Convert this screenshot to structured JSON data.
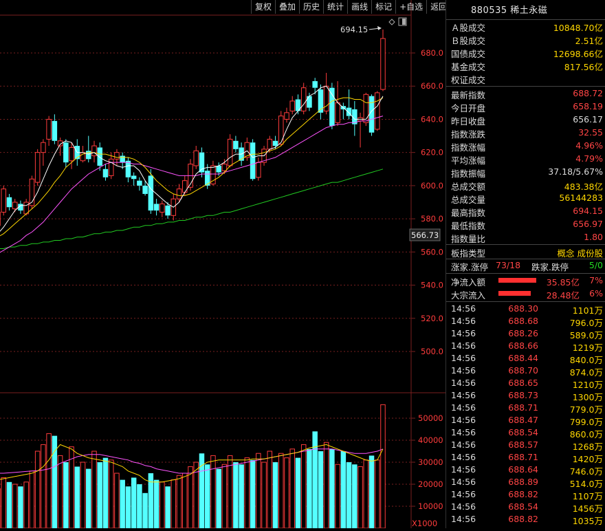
{
  "toolbar": {
    "items": [
      "复权",
      "叠加",
      "历史",
      "统计",
      "画线",
      "标记",
      "+自选",
      "返回"
    ]
  },
  "chart": {
    "high_marker_label": "694.15",
    "current_price_label": "566.73",
    "price_axis": [
      "680.0",
      "660.0",
      "640.0",
      "620.0",
      "600.0",
      "580.0",
      "560.0",
      "540.0",
      "520.0",
      "500.0"
    ],
    "volume_axis": [
      "50000",
      "40000",
      "30000",
      "20000",
      "10000"
    ],
    "volume_unit": "X1000",
    "colors": {
      "up": "#ff3c3c",
      "down": "#54ffff",
      "ma5": "#ffffff",
      "ma10": "#ffd700",
      "ma20": "#ff55ff",
      "ma60": "#22cc22",
      "grid": "#7a1f1f"
    }
  },
  "chart_data": {
    "type": "candlestick",
    "price_ylim": [
      496,
      700
    ],
    "volume_ylim": [
      0,
      58000
    ],
    "candles": [
      {
        "o": 576,
        "c": 584,
        "h": 586,
        "l": 574,
        "v": 18000
      },
      {
        "o": 584,
        "c": 598,
        "h": 600,
        "l": 582,
        "v": 23000
      },
      {
        "o": 593,
        "c": 587,
        "h": 595,
        "l": 585,
        "v": 21000
      },
      {
        "o": 586,
        "c": 590,
        "h": 592,
        "l": 584,
        "v": 20000
      },
      {
        "o": 589,
        "c": 585,
        "h": 591,
        "l": 583,
        "v": 19000
      },
      {
        "o": 583,
        "c": 590,
        "h": 592,
        "l": 582,
        "v": 21000
      },
      {
        "o": 588,
        "c": 604,
        "h": 606,
        "l": 586,
        "v": 26000
      },
      {
        "o": 602,
        "c": 620,
        "h": 622,
        "l": 600,
        "v": 35000
      },
      {
        "o": 620,
        "c": 626,
        "h": 628,
        "l": 612,
        "v": 38000
      },
      {
        "o": 628,
        "c": 640,
        "h": 642,
        "l": 624,
        "v": 43000
      },
      {
        "o": 639,
        "c": 627,
        "h": 643,
        "l": 625,
        "v": 42000
      },
      {
        "o": 624,
        "c": 627,
        "h": 629,
        "l": 618,
        "v": 33000
      },
      {
        "o": 626,
        "c": 614,
        "h": 628,
        "l": 611,
        "v": 30000
      },
      {
        "o": 615,
        "c": 623,
        "h": 626,
        "l": 610,
        "v": 37000
      },
      {
        "o": 624,
        "c": 616,
        "h": 628,
        "l": 612,
        "v": 28000
      },
      {
        "o": 615,
        "c": 620,
        "h": 624,
        "l": 614,
        "v": 30000
      },
      {
        "o": 621,
        "c": 616,
        "h": 630,
        "l": 614,
        "v": 27000
      },
      {
        "o": 618,
        "c": 624,
        "h": 627,
        "l": 614,
        "v": 35000
      },
      {
        "o": 623,
        "c": 612,
        "h": 626,
        "l": 609,
        "v": 30000
      },
      {
        "o": 610,
        "c": 605,
        "h": 613,
        "l": 603,
        "v": 32000
      },
      {
        "o": 606,
        "c": 616,
        "h": 620,
        "l": 604,
        "v": 31000
      },
      {
        "o": 616,
        "c": 620,
        "h": 622,
        "l": 612,
        "v": 25000
      },
      {
        "o": 618,
        "c": 614,
        "h": 620,
        "l": 610,
        "v": 22000
      },
      {
        "o": 615,
        "c": 605,
        "h": 617,
        "l": 602,
        "v": 19000
      },
      {
        "o": 606,
        "c": 604,
        "h": 608,
        "l": 600,
        "v": 23000
      },
      {
        "o": 603,
        "c": 600,
        "h": 605,
        "l": 597,
        "v": 20000
      },
      {
        "o": 600,
        "c": 595,
        "h": 603,
        "l": 594,
        "v": 16000
      },
      {
        "o": 606,
        "c": 585,
        "h": 610,
        "l": 583,
        "v": 25000
      },
      {
        "o": 589,
        "c": 585,
        "h": 592,
        "l": 582,
        "v": 22000
      },
      {
        "o": 584,
        "c": 589,
        "h": 591,
        "l": 581,
        "v": 21000
      },
      {
        "o": 588,
        "c": 582,
        "h": 590,
        "l": 580,
        "v": 19000
      },
      {
        "o": 582,
        "c": 592,
        "h": 595,
        "l": 579,
        "v": 22000
      },
      {
        "o": 592,
        "c": 598,
        "h": 601,
        "l": 590,
        "v": 24000
      },
      {
        "o": 596,
        "c": 603,
        "h": 606,
        "l": 594,
        "v": 25000
      },
      {
        "o": 599,
        "c": 613,
        "h": 616,
        "l": 597,
        "v": 28000
      },
      {
        "o": 612,
        "c": 621,
        "h": 624,
        "l": 610,
        "v": 30000
      },
      {
        "o": 620,
        "c": 608,
        "h": 623,
        "l": 605,
        "v": 34000
      },
      {
        "o": 609,
        "c": 600,
        "h": 613,
        "l": 598,
        "v": 29000
      },
      {
        "o": 601,
        "c": 612,
        "h": 615,
        "l": 600,
        "v": 33000
      },
      {
        "o": 612,
        "c": 608,
        "h": 614,
        "l": 606,
        "v": 27000
      },
      {
        "o": 609,
        "c": 613,
        "h": 616,
        "l": 607,
        "v": 29000
      },
      {
        "o": 612,
        "c": 628,
        "h": 631,
        "l": 611,
        "v": 33000
      },
      {
        "o": 627,
        "c": 622,
        "h": 630,
        "l": 620,
        "v": 30000
      },
      {
        "o": 623,
        "c": 615,
        "h": 626,
        "l": 612,
        "v": 29000
      },
      {
        "o": 617,
        "c": 626,
        "h": 629,
        "l": 615,
        "v": 32000
      },
      {
        "o": 626,
        "c": 604,
        "h": 628,
        "l": 603,
        "v": 31000
      },
      {
        "o": 605,
        "c": 614,
        "h": 617,
        "l": 603,
        "v": 34000
      },
      {
        "o": 614,
        "c": 622,
        "h": 624,
        "l": 612,
        "v": 30000
      },
      {
        "o": 622,
        "c": 628,
        "h": 630,
        "l": 620,
        "v": 35000
      },
      {
        "o": 627,
        "c": 624,
        "h": 630,
        "l": 622,
        "v": 30000
      },
      {
        "o": 625,
        "c": 642,
        "h": 645,
        "l": 624,
        "v": 34000
      },
      {
        "o": 640,
        "c": 644,
        "h": 647,
        "l": 638,
        "v": 32000
      },
      {
        "o": 645,
        "c": 651,
        "h": 654,
        "l": 643,
        "v": 36000
      },
      {
        "o": 652,
        "c": 645,
        "h": 655,
        "l": 643,
        "v": 32000
      },
      {
        "o": 645,
        "c": 659,
        "h": 662,
        "l": 643,
        "v": 38000
      },
      {
        "o": 654,
        "c": 647,
        "h": 656,
        "l": 645,
        "v": 36000
      },
      {
        "o": 663,
        "c": 659,
        "h": 665,
        "l": 655,
        "v": 44000
      },
      {
        "o": 658,
        "c": 644,
        "h": 661,
        "l": 640,
        "v": 35000
      },
      {
        "o": 645,
        "c": 660,
        "h": 668,
        "l": 643,
        "v": 39000
      },
      {
        "o": 659,
        "c": 636,
        "h": 662,
        "l": 634,
        "v": 36000
      },
      {
        "o": 638,
        "c": 650,
        "h": 663,
        "l": 636,
        "v": 29000
      },
      {
        "o": 648,
        "c": 646,
        "h": 650,
        "l": 640,
        "v": 35000
      },
      {
        "o": 647,
        "c": 642,
        "h": 658,
        "l": 640,
        "v": 30000
      },
      {
        "o": 646,
        "c": 637,
        "h": 651,
        "l": 630,
        "v": 29000
      },
      {
        "o": 639,
        "c": 641,
        "h": 644,
        "l": 623,
        "v": 28000
      },
      {
        "o": 638,
        "c": 655,
        "h": 656,
        "l": 636,
        "v": 31000
      },
      {
        "o": 654,
        "c": 632,
        "h": 655,
        "l": 630,
        "v": 33000
      },
      {
        "o": 634,
        "c": 656,
        "h": 657,
        "l": 633,
        "v": 31000
      },
      {
        "o": 658,
        "c": 688.72,
        "h": 694.15,
        "l": 656.97,
        "v": 56144
      }
    ],
    "ma5": [
      571,
      575,
      580,
      585,
      588,
      588,
      590,
      596,
      604,
      612,
      619,
      625,
      627,
      626,
      620,
      620,
      619,
      620,
      617,
      615,
      614,
      612,
      611,
      612,
      612,
      609,
      603,
      598,
      595,
      592,
      589,
      587,
      590,
      596,
      601,
      607,
      610,
      611,
      611,
      612,
      614,
      617,
      619,
      619,
      621,
      617,
      618,
      618,
      622,
      623,
      626,
      634,
      641,
      645,
      649,
      654,
      656,
      659,
      660,
      655,
      650,
      647,
      644,
      640,
      640,
      640,
      645,
      648,
      654
    ],
    "ma10": [
      569,
      571,
      574,
      577,
      580,
      583,
      586,
      589,
      593,
      597,
      602,
      606,
      611,
      614,
      617,
      619,
      620,
      620,
      619,
      619,
      618,
      617,
      617,
      617,
      616,
      614,
      611,
      607,
      603,
      600,
      597,
      595,
      594,
      594,
      595,
      597,
      599,
      601,
      603,
      605,
      608,
      612,
      614,
      616,
      618,
      619,
      619,
      620,
      621,
      622,
      624,
      628,
      631,
      634,
      637,
      640,
      643,
      646,
      648,
      651,
      652,
      653,
      653,
      652,
      652,
      650,
      650,
      651,
      653
    ],
    "ma20": [
      559,
      561,
      563,
      565,
      567,
      570,
      572,
      575,
      578,
      582,
      586,
      590,
      594,
      598,
      601,
      604,
      607,
      609,
      611,
      613,
      614,
      614,
      614,
      614,
      613,
      613,
      612,
      611,
      610,
      609,
      608,
      607,
      606,
      606,
      606,
      606,
      607,
      607,
      607,
      607,
      608,
      609,
      610,
      611,
      612,
      613,
      614,
      615,
      616,
      617,
      619,
      621,
      623,
      625,
      627,
      629,
      631,
      633,
      635,
      636,
      637,
      637,
      638,
      638,
      639,
      639,
      640,
      641,
      642
    ],
    "ma60": [
      562,
      562,
      563,
      563,
      564,
      564,
      565,
      565,
      566,
      566,
      567,
      567,
      568,
      568,
      569,
      569,
      570,
      571,
      571,
      572,
      572,
      573,
      573,
      574,
      575,
      575,
      576,
      576,
      577,
      577,
      578,
      578,
      579,
      579,
      580,
      581,
      581,
      582,
      582,
      583,
      584,
      584,
      585,
      586,
      587,
      588,
      589,
      590,
      591,
      592,
      593,
      594,
      595,
      596,
      597,
      598,
      599,
      600,
      601,
      602,
      602,
      603,
      604,
      605,
      606,
      607,
      608,
      609,
      610
    ],
    "vol_ma5": [
      22000,
      22500,
      23000,
      23500,
      24000,
      24500,
      25000,
      26000,
      28000,
      31000,
      35000,
      38000,
      37000,
      36000,
      34000,
      33000,
      32000,
      31500,
      31000,
      30500,
      30000,
      29000,
      28000,
      26000,
      25000,
      24000,
      22000,
      21000,
      21000,
      21000,
      21500,
      22000,
      22500,
      23500,
      24500,
      26500,
      28500,
      30000,
      30500,
      31000,
      31000,
      31000,
      31000,
      31000,
      31000,
      31500,
      31500,
      31500,
      32000,
      32500,
      33000,
      33500,
      34000,
      34500,
      35500,
      36500,
      37000,
      37500,
      38000,
      37000,
      36000,
      35000,
      34000,
      33000,
      32000,
      31000,
      30500,
      31000,
      36000
    ],
    "vol_ma10": [
      25000,
      25000,
      25200,
      25400,
      25600,
      25800,
      26000,
      26200,
      26500,
      27000,
      28000,
      29500,
      30500,
      31500,
      32500,
      33000,
      33500,
      33500,
      33500,
      33000,
      32500,
      32000,
      31500,
      31000,
      30000,
      29500,
      28500,
      28000,
      27000,
      26500,
      26000,
      25500,
      25000,
      25000,
      25000,
      25500,
      26000,
      26500,
      27000,
      27500,
      28000,
      28500,
      29000,
      29500,
      30000,
      30500,
      31000,
      31500,
      32000,
      32500,
      33000,
      33500,
      34000,
      34500,
      35000,
      35500,
      36000,
      36000,
      36000,
      36000,
      35500,
      35000,
      34500,
      34000,
      34000,
      34000,
      34500,
      35000,
      36000
    ]
  },
  "panel": {
    "title": "880535 稀土永磁",
    "market_rows": [
      {
        "k": "Ａ股成交",
        "v": "10848.70亿",
        "color": "#ffd700"
      },
      {
        "k": "Ｂ股成交",
        "v": "2.51亿",
        "color": "#ffd700"
      },
      {
        "k": "国债成交",
        "v": "12698.66亿",
        "color": "#ffd700"
      },
      {
        "k": "基金成交",
        "v": "817.56亿",
        "color": "#ffd700"
      },
      {
        "k": "权证成交",
        "v": "",
        "color": "#ffd700"
      }
    ],
    "index_rows": [
      {
        "k": "最新指数",
        "v": "688.72",
        "color": "#ff4545"
      },
      {
        "k": "今日开盘",
        "v": "658.19",
        "color": "#ff4545"
      },
      {
        "k": "昨日收盘",
        "v": "656.17",
        "color": "#dddddd"
      },
      {
        "k": "指数涨跌",
        "v": "32.55",
        "color": "#ff4545"
      },
      {
        "k": "指数涨幅",
        "v": "4.96%",
        "color": "#ff4545"
      },
      {
        "k": "平均涨幅",
        "v": "4.79%",
        "color": "#ff4545"
      },
      {
        "k": "指数振幅",
        "v": "37.18/5.67%",
        "color": "#dddddd"
      },
      {
        "k": "总成交额",
        "v": "483.38亿",
        "color": "#ffd700"
      },
      {
        "k": "总成交量",
        "v": "56144283",
        "color": "#ffd700"
      },
      {
        "k": "最高指数",
        "v": "694.15",
        "color": "#ff4545"
      },
      {
        "k": "最低指数",
        "v": "656.97",
        "color": "#ff4545"
      },
      {
        "k": "指数量比",
        "v": "1.80",
        "color": "#ff4545"
      }
    ],
    "sector_type_label": "板指类型",
    "sector_type_value": "概念 成份股",
    "up_limit_label": "涨家.涨停",
    "up_limit_value": "73/18",
    "down_limit_label": "跌家.跌停",
    "down_limit_value": "5/0",
    "net_inflow_label": "净流入额",
    "net_inflow_value": "35.85亿",
    "net_inflow_pct": "7%",
    "net_inflow_level": 0.7,
    "block_inflow_label": "大宗流入",
    "block_inflow_value": "28.48亿",
    "block_inflow_pct": "6%",
    "block_inflow_level": 0.6,
    "ticks": [
      {
        "t": "14:56",
        "p": "688.30",
        "v": "1101万"
      },
      {
        "t": "14:56",
        "p": "688.68",
        "v": "796.0万"
      },
      {
        "t": "14:56",
        "p": "688.26",
        "v": "589.0万"
      },
      {
        "t": "14:56",
        "p": "688.66",
        "v": "1219万"
      },
      {
        "t": "14:56",
        "p": "688.44",
        "v": "840.0万"
      },
      {
        "t": "14:56",
        "p": "688.70",
        "v": "874.0万"
      },
      {
        "t": "14:56",
        "p": "688.65",
        "v": "1210万"
      },
      {
        "t": "14:56",
        "p": "688.73",
        "v": "1300万"
      },
      {
        "t": "14:56",
        "p": "688.71",
        "v": "779.0万"
      },
      {
        "t": "14:56",
        "p": "688.47",
        "v": "799.0万"
      },
      {
        "t": "14:56",
        "p": "688.54",
        "v": "860.0万"
      },
      {
        "t": "14:56",
        "p": "688.57",
        "v": "1268万"
      },
      {
        "t": "14:56",
        "p": "688.71",
        "v": "1420万"
      },
      {
        "t": "14:56",
        "p": "688.64",
        "v": "746.0万"
      },
      {
        "t": "14:56",
        "p": "688.89",
        "v": "514.0万"
      },
      {
        "t": "14:56",
        "p": "688.82",
        "v": "1107万"
      },
      {
        "t": "14:56",
        "p": "688.54",
        "v": "1456万"
      },
      {
        "t": "14:56",
        "p": "688.82",
        "v": "1035万"
      }
    ]
  }
}
